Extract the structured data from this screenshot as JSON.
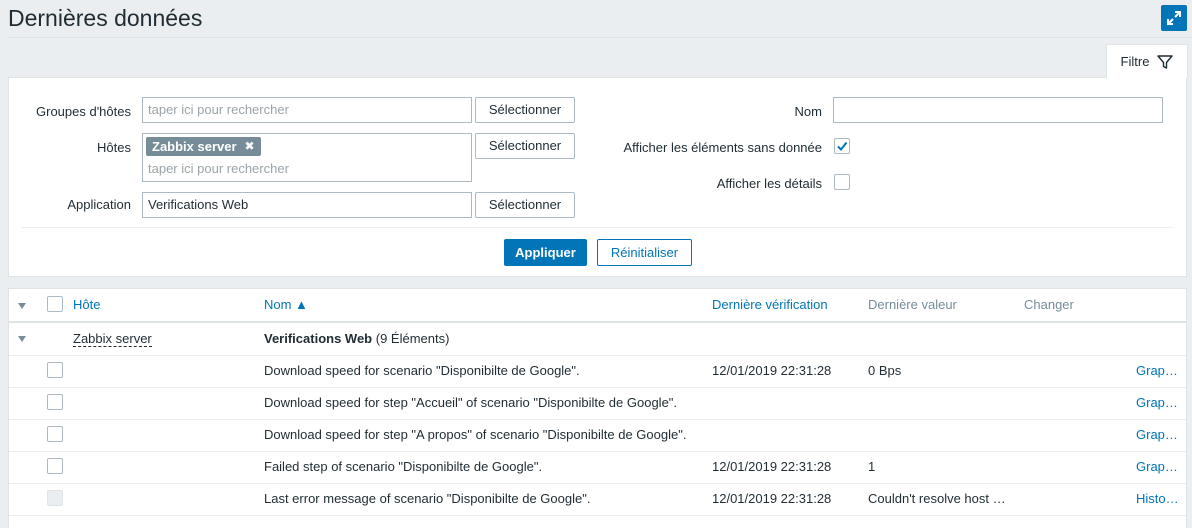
{
  "page": {
    "title": "Dernières données"
  },
  "filter": {
    "tab_label": "Filtre",
    "host_groups": {
      "label": "Groupes d'hôtes",
      "placeholder": "taper ici pour rechercher",
      "select_label": "Sélectionner"
    },
    "hosts": {
      "label": "Hôtes",
      "tag": "Zabbix server",
      "placeholder": "taper ici pour rechercher",
      "select_label": "Sélectionner"
    },
    "application": {
      "label": "Application",
      "value": "Verifications Web",
      "select_label": "Sélectionner"
    },
    "name": {
      "label": "Nom",
      "value": ""
    },
    "show_without_data": {
      "label": "Afficher les éléments sans donnée",
      "checked": true
    },
    "show_details": {
      "label": "Afficher les détails",
      "checked": false
    },
    "apply_label": "Appliquer",
    "reset_label": "Réinitialiser"
  },
  "table": {
    "headers": {
      "host": "Hôte",
      "name": "Nom ▲",
      "last_check": "Dernière vérification",
      "last_value": "Dernière valeur",
      "change": "Changer"
    },
    "group": {
      "host": "Zabbix server",
      "app_name": "Verifications Web",
      "app_count": "(9 Éléments)"
    },
    "rows": [
      {
        "name": "Download speed for scenario \"Disponibilte de Google\".",
        "last_check": "12/01/2019 22:31:28",
        "last_value": "0 Bps",
        "change": "",
        "action": "Grap…"
      },
      {
        "name": "Download speed for step \"Accueil\" of scenario \"Disponibilte de Google\".",
        "last_check": "",
        "last_value": "",
        "change": "",
        "action": "Grap…"
      },
      {
        "name": "Download speed for step \"A propos\" of scenario \"Disponibilte de Google\".",
        "last_check": "",
        "last_value": "",
        "change": "",
        "action": "Grap…"
      },
      {
        "name": "Failed step of scenario \"Disponibilte de Google\".",
        "last_check": "12/01/2019 22:31:28",
        "last_value": "1",
        "change": "",
        "action": "Grap…"
      },
      {
        "name": "Last error message of scenario \"Disponibilte de Google\".",
        "last_check": "12/01/2019 22:31:28",
        "last_value": "Couldn't resolve host …",
        "change": "",
        "action": "Histo…"
      }
    ]
  },
  "colors": {
    "accent": "#0275b8",
    "tag_bg": "#768d99",
    "page_bg": "#ebeef0"
  }
}
